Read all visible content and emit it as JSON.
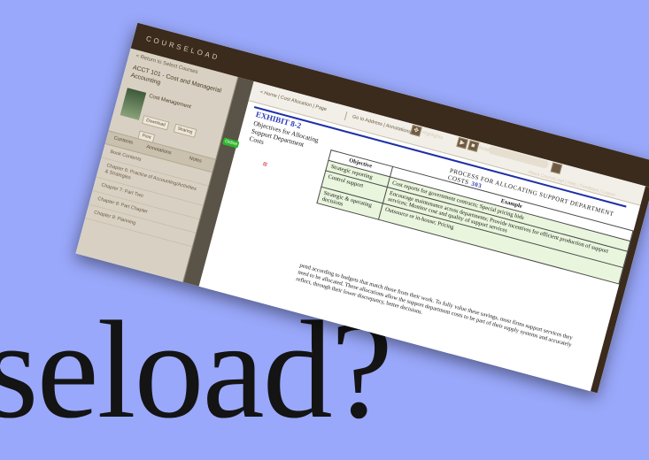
{
  "headline": {
    "text": "seload?"
  },
  "app": {
    "logo": "COURSELOAD",
    "sidebar": {
      "back_label": "< Return to Select Courses",
      "course_title": "ACCT 101 - Cost and Managerial Accounting",
      "book_title": "Cost Management",
      "buttons": [
        "Download",
        "Sharing",
        "Print"
      ],
      "tabs": [
        "Contents",
        "Annotations",
        "Notes"
      ],
      "items": [
        "Book Contents",
        "Chapter 6: Practice of Accounting/Activities & Strategies",
        "Chapter 7: Part Two",
        "Chapter 8: Part Chapter",
        "Chapter 9: Planning"
      ],
      "status_badge": "Online"
    },
    "toolbar": {
      "view_label": "< Home  |  Cost Allocation  |  Page",
      "page_label": "Go to Address | Annotations",
      "highlights_label": "Highlights",
      "notes_label": "Notes",
      "help_label": "About CourseLoad | Help | Feedback | Logout"
    },
    "page": {
      "exhibit_title": "EXHIBIT 8-2",
      "exhibit_subtitle": "Objectives for Allocating Support Department Costs",
      "running_head": "PROCESS FOR ALLOCATING SUPPORT DEPARTMENT COSTS",
      "page_number": "303",
      "table": {
        "headers": [
          "Objective",
          "Example"
        ],
        "rows": [
          [
            "Strategic reporting",
            "Cost reports for government contracts; Special pricing bids"
          ],
          [
            "Control support",
            "Encourage maintenance across departments; Provide incentives for efficient production of support services; Monitor cost and quality of support services"
          ],
          [
            "Strategic & operating decisions",
            "Outsource or in-house; Pricing"
          ]
        ]
      },
      "body": "pend according to budgets that match those from their work. To fully value these savings, most firms support services they need to be allocated. These allocations allow the support department costs to be part of their supply systems and accurately reflect, through their lower discrepancy, better decisions."
    }
  }
}
